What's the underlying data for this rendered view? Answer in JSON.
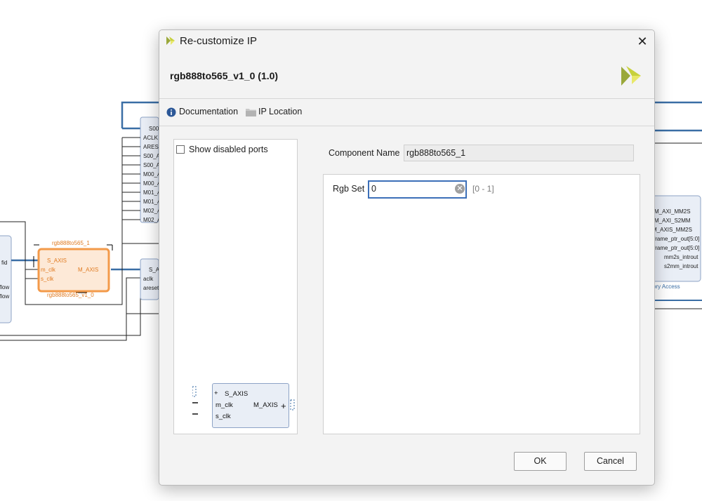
{
  "background": {
    "left_block": {
      "ports": [
        "S_AXIS",
        "m_clk",
        "s_clk"
      ],
      "right_port": "M_AXIS",
      "name_top": "rgb888to565_1",
      "name_bottom": "rgb888to565_v1_0",
      "partial_left_labels": [
        "fid",
        "flow",
        "flow"
      ]
    },
    "interconnect_ports": [
      "S00",
      "ACLK",
      "ARESE",
      "S00_A",
      "S00_A",
      "M00_A",
      "M00_A",
      "M01_A",
      "M01_A",
      "M02_A",
      "M02_A"
    ],
    "axis_block_ports": [
      "S_A",
      "aclk",
      "areset"
    ],
    "vdma_ports": [
      "M_AXI_MM2S",
      "M_AXI_S2MM",
      "M_AXIS_MM2S",
      "frame_ptr_out[5:0]",
      "frame_ptr_out[5:0]",
      "mm2s_introut",
      "s2mm_introut"
    ],
    "vdma_caption": "ory Access"
  },
  "dialog": {
    "title": "Re-customize IP",
    "close_glyph": "✕",
    "header_title": "rgb888to565_v1_0 (1.0)",
    "toolbar": {
      "documentation_label": "Documentation",
      "ip_location_label": "IP Location"
    },
    "left_panel": {
      "show_disabled_ports_label": "Show disabled ports",
      "show_disabled_ports_checked": false,
      "block": {
        "left_ports": [
          "S_AXIS",
          "m_clk",
          "s_clk"
        ],
        "right_port": "M_AXIS"
      }
    },
    "component_name_label": "Component Name",
    "component_name_value": "rgb888to565_1",
    "params": {
      "rgb_set_label": "Rgb Set",
      "rgb_set_value": "0",
      "rgb_set_range": "[0 - 1]",
      "clear_glyph": "✕"
    },
    "buttons": {
      "ok_label": "OK",
      "cancel_label": "Cancel"
    }
  },
  "colors": {
    "accent": "#3c6fb8",
    "selected_block": "#f39a4a",
    "block_fill": "#e9eef6",
    "wire": "#2f4f80"
  }
}
